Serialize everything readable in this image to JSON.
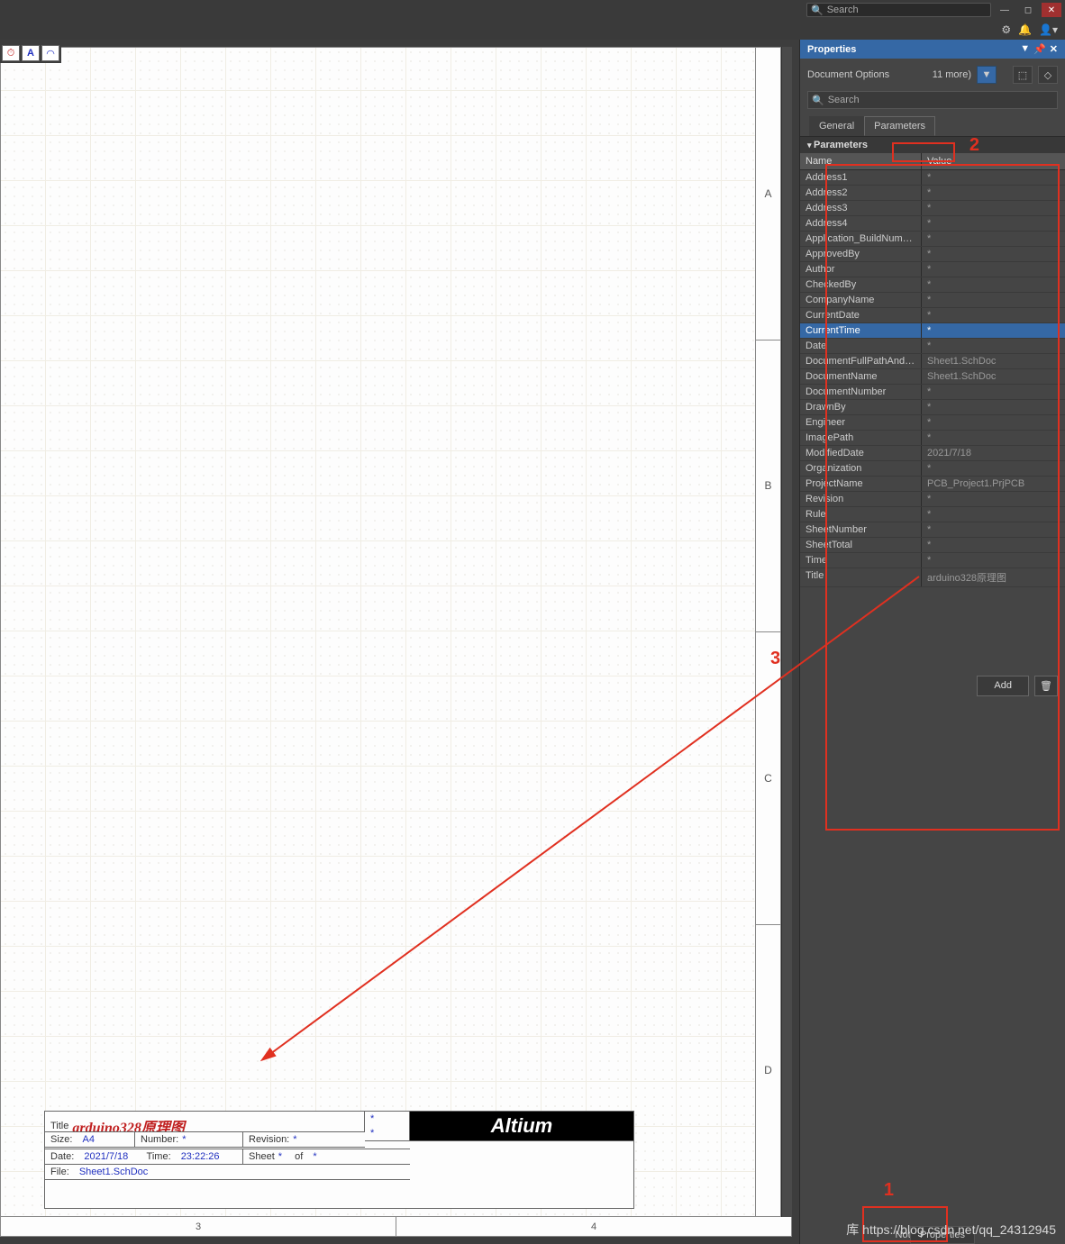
{
  "top_search_placeholder": "Search",
  "panel_title": "Properties",
  "doc_options_label": "Document Options",
  "doc_options_more": "11 more)",
  "panel_search_placeholder": "Search",
  "tabs": {
    "general": "General",
    "parameters": "Parameters"
  },
  "section_parameters": "Parameters",
  "col_name": "Name",
  "col_value": "Value",
  "params": [
    {
      "n": "Address1",
      "v": "*"
    },
    {
      "n": "Address2",
      "v": "*"
    },
    {
      "n": "Address3",
      "v": "*"
    },
    {
      "n": "Address4",
      "v": "*"
    },
    {
      "n": "Application_BuildNumber",
      "v": "*"
    },
    {
      "n": "ApprovedBy",
      "v": "*"
    },
    {
      "n": "Author",
      "v": "*"
    },
    {
      "n": "CheckedBy",
      "v": "*"
    },
    {
      "n": "CompanyName",
      "v": "*"
    },
    {
      "n": "CurrentDate",
      "v": "*"
    },
    {
      "n": "CurrentTime",
      "v": "*",
      "sel": true
    },
    {
      "n": "Date",
      "v": "*"
    },
    {
      "n": "DocumentFullPathAndName",
      "v": "Sheet1.SchDoc"
    },
    {
      "n": "DocumentName",
      "v": "Sheet1.SchDoc"
    },
    {
      "n": "DocumentNumber",
      "v": "*"
    },
    {
      "n": "DrawnBy",
      "v": "*"
    },
    {
      "n": "Engineer",
      "v": "*"
    },
    {
      "n": "ImagePath",
      "v": "*"
    },
    {
      "n": "ModifiedDate",
      "v": "2021/7/18"
    },
    {
      "n": "Organization",
      "v": "*"
    },
    {
      "n": "ProjectName",
      "v": "PCB_Project1.PrjPCB"
    },
    {
      "n": "Revision",
      "v": "*"
    },
    {
      "n": "Rule",
      "v": "*"
    },
    {
      "n": "SheetNumber",
      "v": "*"
    },
    {
      "n": "SheetTotal",
      "v": "*"
    },
    {
      "n": "Time",
      "v": "*"
    },
    {
      "n": "Title",
      "v": "arduino328原理图"
    }
  ],
  "add_btn": "Add",
  "status_text": "Nothing selected",
  "status_tab": "Properties",
  "margin_right": [
    "A",
    "B",
    "C",
    "D"
  ],
  "margin_bottom": [
    "3",
    "4"
  ],
  "title_block": {
    "title_label": "Title",
    "title_val": "arduino328原理图",
    "size_label": "Size:",
    "size_val": "A4",
    "number_label": "Number:",
    "number_val": "*",
    "revision_label": "Revision:",
    "revision_val": "*",
    "date_label": "Date:",
    "date_val": "2021/7/18",
    "time_label": "Time:",
    "time_val": "23:22:26",
    "sheet_label": "Sheet",
    "sheet_val": "*",
    "of_label": "of",
    "of_val": "*",
    "file_label": "File:",
    "file_val": "Sheet1.SchDoc",
    "logo": "Altium"
  },
  "annot": {
    "1": "1",
    "2": "2",
    "3": "3"
  },
  "watermark": "库 https://blog.csdn.net/qq_24312945"
}
